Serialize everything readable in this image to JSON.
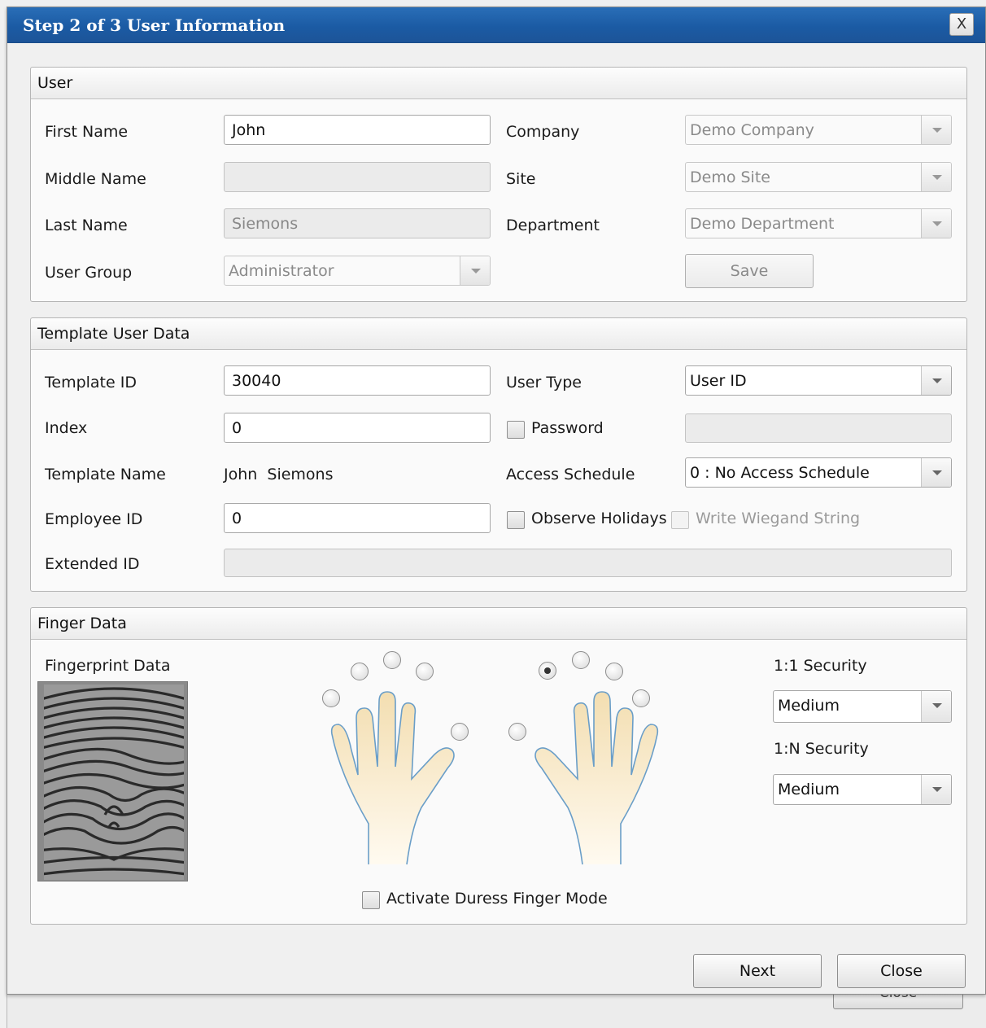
{
  "dialog": {
    "title": "Step 2 of 3 User Information",
    "close_glyph": "X"
  },
  "user_group": {
    "header": "User",
    "first_name_label": "First Name",
    "first_name_value": "John",
    "middle_name_label": "Middle Name",
    "middle_name_value": "",
    "last_name_label": "Last Name",
    "last_name_value": "Siemons",
    "user_group_label": "User Group",
    "user_group_value": "Administrator",
    "company_label": "Company",
    "company_value": "Demo Company",
    "site_label": "Site",
    "site_value": "Demo Site",
    "department_label": "Department",
    "department_value": "Demo Department",
    "save_label": "Save"
  },
  "template_group": {
    "header": "Template User Data",
    "template_id_label": "Template ID",
    "template_id_value": "30040",
    "index_label": "Index",
    "index_value": "0",
    "template_name_label": "Template Name",
    "template_name_value": "John  Siemons",
    "employee_id_label": "Employee ID",
    "employee_id_value": "0",
    "extended_id_label": "Extended ID",
    "extended_id_value": "",
    "user_type_label": "User Type",
    "user_type_value": "User ID",
    "password_label": "Password",
    "password_value": "",
    "access_schedule_label": "Access Schedule",
    "access_schedule_value": "0 : No Access Schedule",
    "observe_holidays_label": "Observe Holidays",
    "write_wiegand_label": "Write Wiegand String"
  },
  "finger_group": {
    "header": "Finger Data",
    "fingerprint_label": "Fingerprint Data",
    "duress_label": "Activate Duress Finger Mode",
    "security_1_1_label": "1:1 Security",
    "security_1_1_value": "Medium",
    "security_1_n_label": "1:N Security",
    "security_1_n_value": "Medium",
    "selected_finger": "right-thumb"
  },
  "footer": {
    "next_label": "Next",
    "close_label": "Close"
  },
  "background": {
    "partial_button_label": "Close"
  }
}
